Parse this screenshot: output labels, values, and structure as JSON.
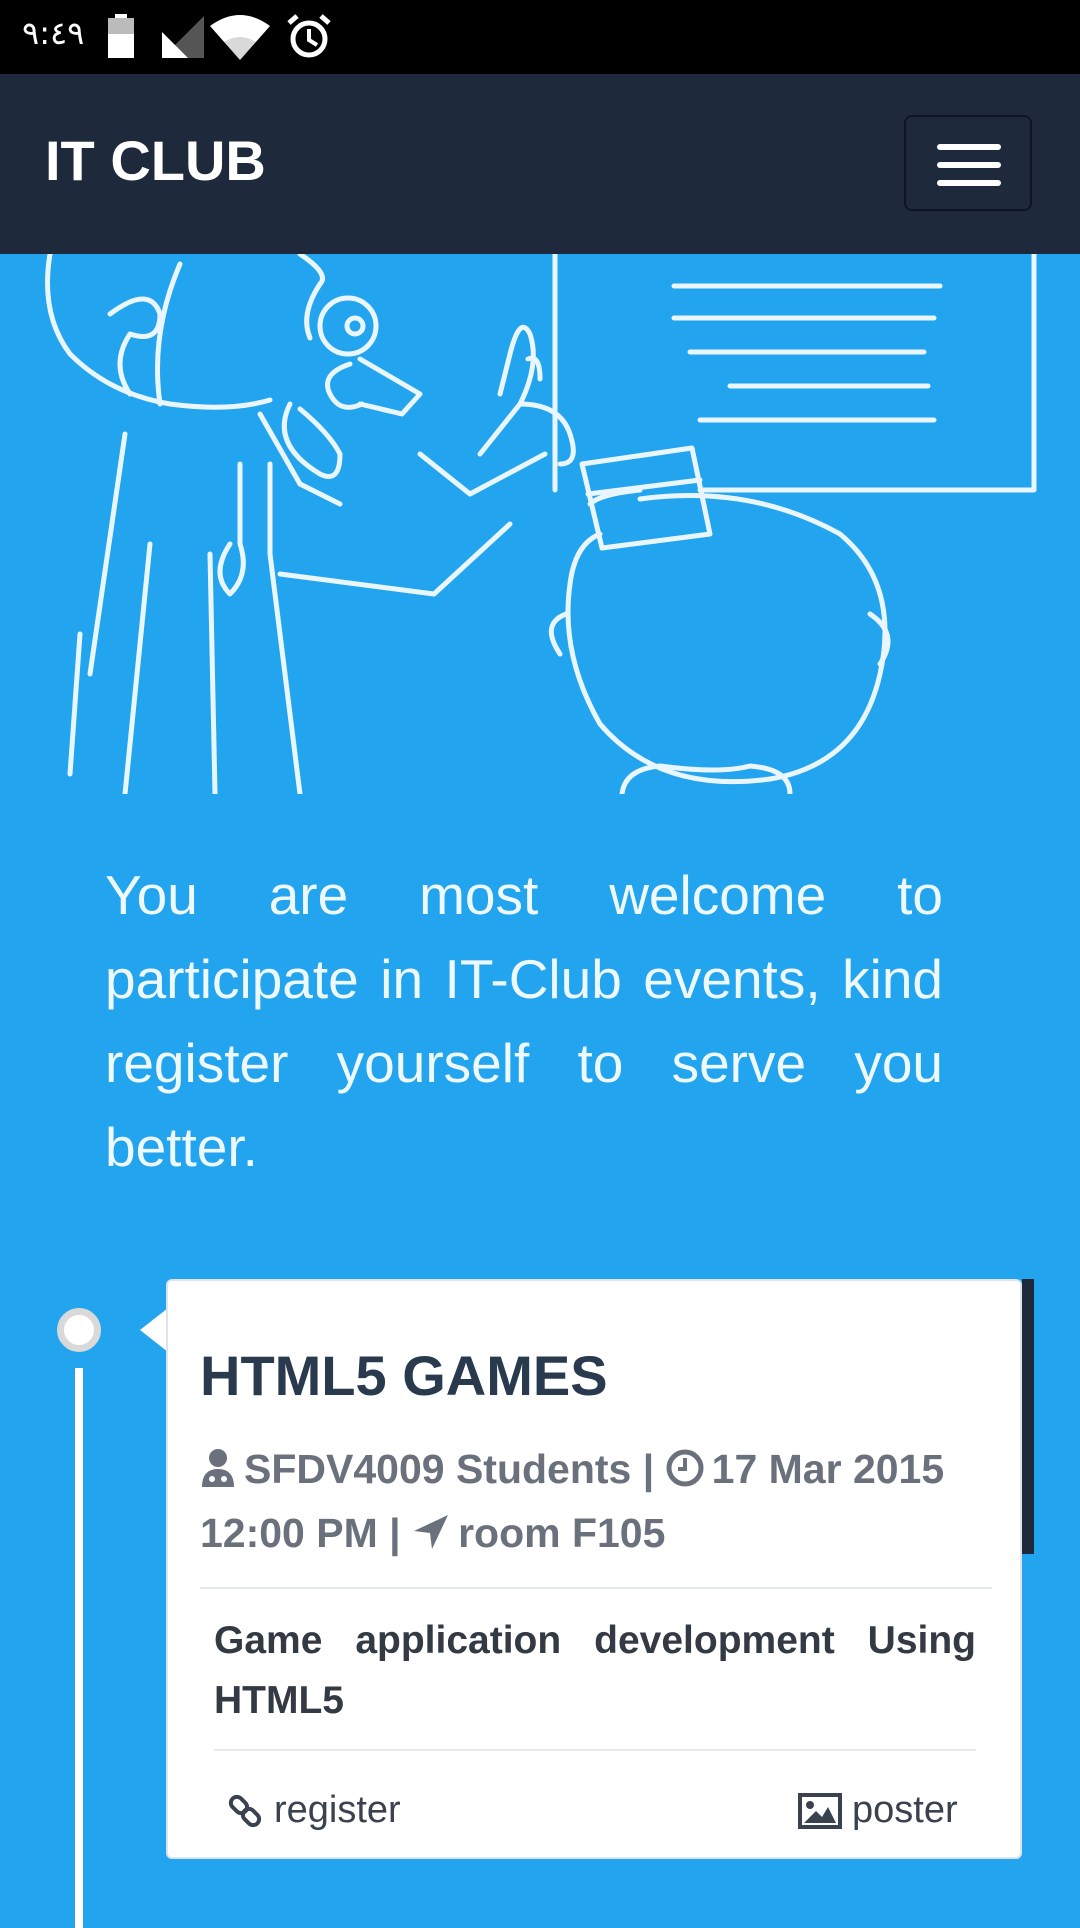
{
  "status_bar": {
    "time": "٩:٤٩",
    "icons": [
      "battery-icon",
      "signal-icon",
      "wifi-icon",
      "alarm-icon"
    ]
  },
  "navbar": {
    "brand": "IT CLUB",
    "menu_icon": "hamburger-menu-icon"
  },
  "hero": {
    "illustration": "teacher-whiteboard-illustration"
  },
  "welcome_text": "You are most welcome to participate in IT-Club events, kind register yourself to serve you better.",
  "events": [
    {
      "title": "HTML5 GAMES",
      "audience": "SFDV4009 Students",
      "datetime": "17 Mar 2015 12:00 PM",
      "location": "room F105",
      "separator": "|",
      "description": "Game application development Using HTML5",
      "register_label": "register",
      "poster_label": "poster"
    }
  ],
  "colors": {
    "background": "#22a5ee",
    "navbar": "#1e2a3c",
    "card": "#ffffff",
    "title": "#2a3a4e"
  }
}
